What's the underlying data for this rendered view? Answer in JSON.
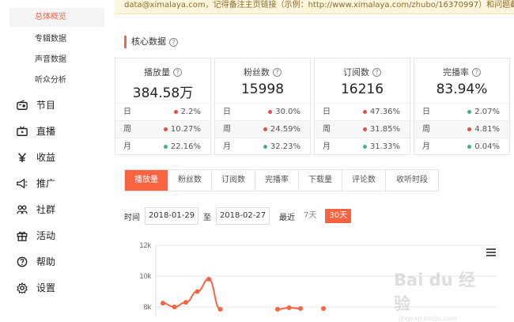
{
  "notice": "data@ximalaya.com，记得备注主页链接（示例：http://www.ximalaya.com/zhubo/16370997）和问题截图哦",
  "sidebar": {
    "sub_items": [
      {
        "label": "总体概览",
        "active": true
      },
      {
        "label": "专辑数据",
        "active": false
      },
      {
        "label": "声音数据",
        "active": false
      },
      {
        "label": "听众分析",
        "active": false
      }
    ],
    "nav_items": [
      {
        "label": "节目",
        "icon": "radio-icon"
      },
      {
        "label": "直播",
        "icon": "live-tv-icon"
      },
      {
        "label": "收益",
        "icon": "yen-icon"
      },
      {
        "label": "推广",
        "icon": "megaphone-icon"
      },
      {
        "label": "社群",
        "icon": "group-icon"
      },
      {
        "label": "活动",
        "icon": "gift-icon"
      },
      {
        "label": "帮助",
        "icon": "help-icon"
      },
      {
        "label": "设置",
        "icon": "gear-icon"
      }
    ]
  },
  "section_title": "核心数据",
  "question_glyph": "?",
  "cards": [
    {
      "label": "播放量",
      "value": "384.58万",
      "rows": [
        {
          "period": "日",
          "value": "2.2%",
          "color": "#e84b4b"
        },
        {
          "period": "周",
          "value": "10.27%",
          "color": "#e84b4b"
        },
        {
          "period": "月",
          "value": "22.16%",
          "color": "#3fb27f"
        }
      ]
    },
    {
      "label": "粉丝数",
      "value": "15998",
      "rows": [
        {
          "period": "日",
          "value": "30.0%",
          "color": "#e84b4b"
        },
        {
          "period": "周",
          "value": "24.59%",
          "color": "#e84b4b"
        },
        {
          "period": "月",
          "value": "32.23%",
          "color": "#3fb27f"
        }
      ]
    },
    {
      "label": "订阅数",
      "value": "16216",
      "rows": [
        {
          "period": "日",
          "value": "47.36%",
          "color": "#e84b4b"
        },
        {
          "period": "周",
          "value": "31.85%",
          "color": "#e84b4b"
        },
        {
          "period": "月",
          "value": "31.33%",
          "color": "#3fb27f"
        }
      ]
    },
    {
      "label": "完播率",
      "value": "83.94%",
      "rows": [
        {
          "period": "日",
          "value": "2.07%",
          "color": "#3fb27f"
        },
        {
          "period": "周",
          "value": "4.81%",
          "color": "#e84b4b"
        },
        {
          "period": "月",
          "value": "0.04%",
          "color": "#3fb27f"
        }
      ]
    }
  ],
  "tabs": [
    {
      "label": "播放量",
      "active": true
    },
    {
      "label": "粉丝数",
      "active": false
    },
    {
      "label": "订阅数",
      "active": false
    },
    {
      "label": "完播率",
      "active": false
    },
    {
      "label": "下载量",
      "active": false
    },
    {
      "label": "评论数",
      "active": false
    },
    {
      "label": "收听时段",
      "active": false
    }
  ],
  "filter": {
    "time_label": "时间",
    "start_date": "2018-01-29",
    "to_label": "至",
    "end_date": "2018-02-27",
    "recent_label": "最近",
    "ranges": [
      {
        "label": "7天",
        "active": false
      },
      {
        "label": "30天",
        "active": true
      }
    ]
  },
  "watermark": {
    "main": "Bai du 经验",
    "sub": "jingyan.baidu.com"
  },
  "colors": {
    "accent": "#f86442",
    "up": "#e84b4b",
    "down": "#3fb27f"
  },
  "chart_data": {
    "type": "line",
    "y_ticks": [
      "12k",
      "10k",
      "8k"
    ],
    "ylim": [
      7500,
      12500
    ],
    "series": [
      {
        "values": [
          8250,
          8000,
          8300,
          9000,
          9800,
          7850,
          null,
          null,
          null,
          null,
          7850,
          7950,
          7900,
          null,
          7900
        ]
      }
    ],
    "grid": true
  }
}
